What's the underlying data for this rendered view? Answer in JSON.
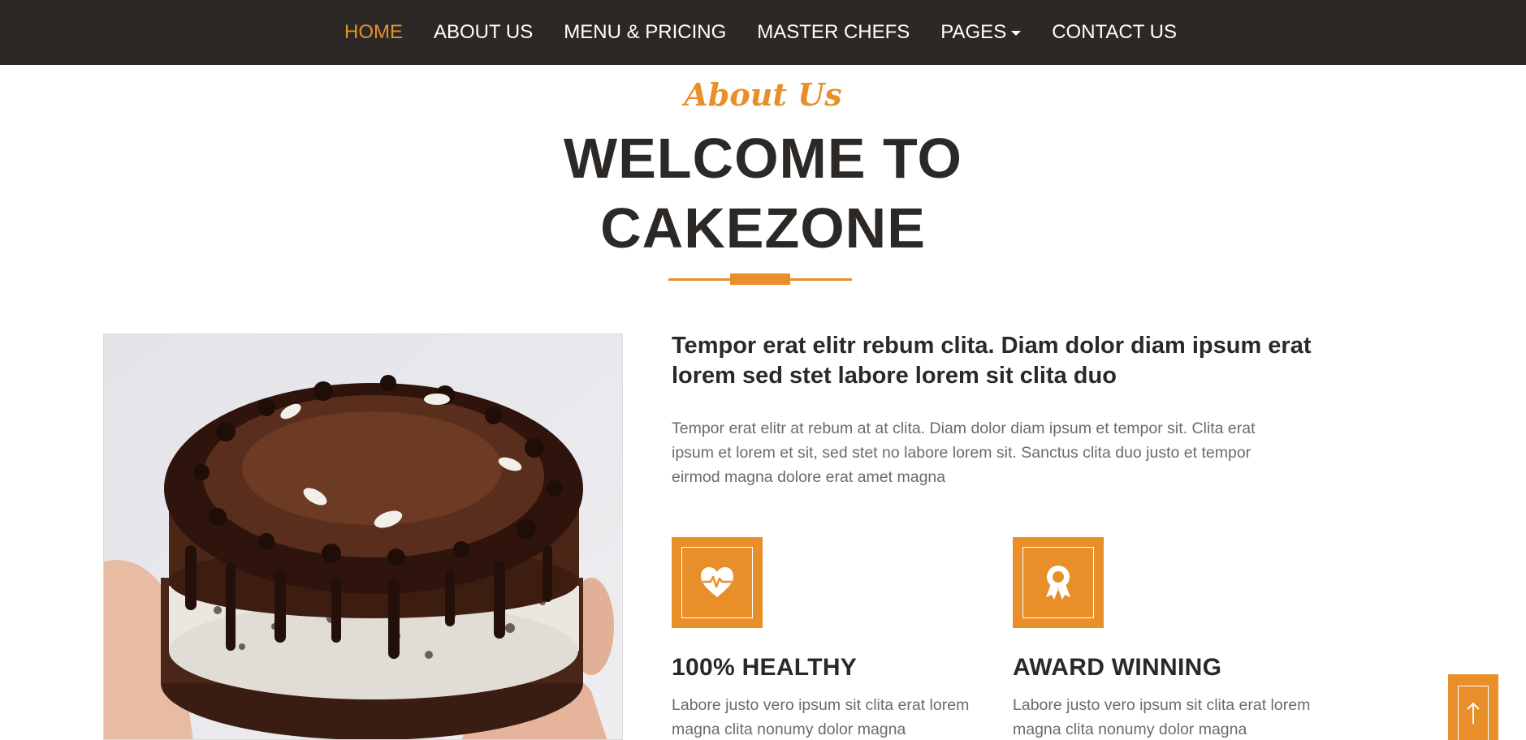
{
  "nav": {
    "items": [
      {
        "label": "HOME",
        "active": true
      },
      {
        "label": "ABOUT US",
        "active": false
      },
      {
        "label": "MENU & PRICING",
        "active": false
      },
      {
        "label": "MASTER CHEFS",
        "active": false
      },
      {
        "label": "PAGES",
        "active": false,
        "dropdown": true
      },
      {
        "label": "CONTACT US",
        "active": false
      }
    ]
  },
  "section": {
    "eyebrow": "About Us",
    "title_line1": "WELCOME TO",
    "title_line2": "CAKEZONE"
  },
  "about": {
    "lead": "Tempor erat elitr rebum clita. Diam dolor diam ipsum erat lorem sed stet labore lorem sit clita duo",
    "body": "Tempor erat elitr at rebum at at clita. Diam dolor diam ipsum et tempor sit. Clita erat ipsum et lorem et sit, sed stet no labore lorem sit. Sanctus clita duo justo et tempor eirmod magna dolore erat amet magna"
  },
  "features": [
    {
      "icon": "heart-pulse-icon",
      "title": "100% HEALTHY",
      "text": "Labore justo vero ipsum sit clita erat lorem magna clita nonumy dolor magna"
    },
    {
      "icon": "award-icon",
      "title": "AWARD WINNING",
      "text": "Labore justo vero ipsum sit clita erat lorem magna clita nonumy dolor magna"
    }
  ],
  "colors": {
    "accent": "#e88f2a",
    "dark": "#2b2825",
    "muted_text": "#6b6b6b"
  },
  "back_to_top": {
    "icon": "arrow-up-icon"
  }
}
